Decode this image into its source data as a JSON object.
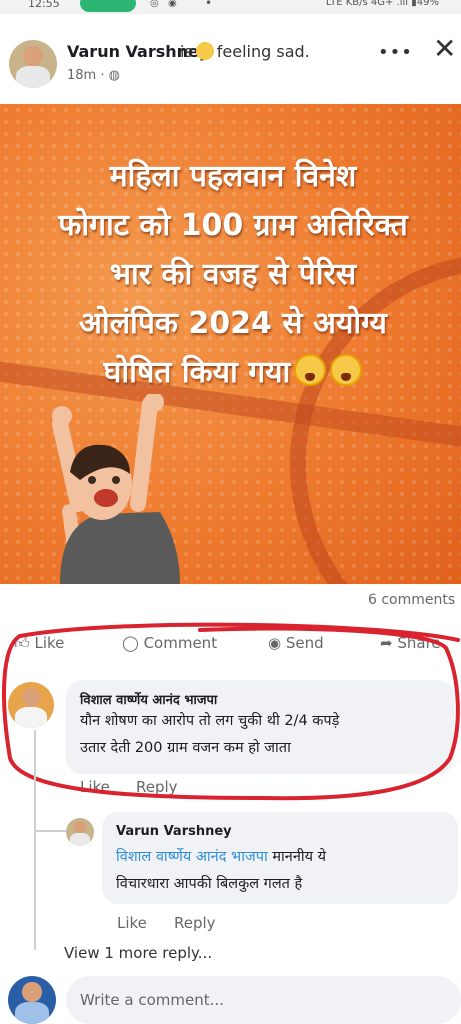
{
  "status_bar": {
    "time": "12:55",
    "network": "LTE KB/s 4G+ .ıll",
    "battery": "49%"
  },
  "post": {
    "author": "Varun Varshney",
    "feeling_prefix": "is",
    "feeling_text": "feeling sad.",
    "time": "18m ·",
    "headline_lines": [
      "महिला पहलवान विनेश",
      "फोगाट को 100 ग्राम अतिरिक्त",
      "भार की वजह से पेरिस",
      "ओलंपिक 2024 से  अयोग्य",
      "घोषित किया गया"
    ],
    "comments_count": "6 comments"
  },
  "actions": {
    "like": "Like",
    "comment": "Comment",
    "send": "Send",
    "share": "Share"
  },
  "comments": [
    {
      "author": "विशाल वार्ष्णेय आनंद भाजपा",
      "text_line1": "यौन शोषण का आरोप तो लग चुकी थी 2/4 कपड़े",
      "text_line2": "उतार देती 200 ग्राम वजन कम हो जाता",
      "like": "Like",
      "reply": "Reply"
    }
  ],
  "reply": {
    "author": "Varun Varshney",
    "mention": "विशाल वार्ष्णेय आनंद भाजपा",
    "text_after_mention": " माननीय ये",
    "text_line2": "विचारधारा आपकी बिलकुल गलत है",
    "like": "Like",
    "reply": "Reply"
  },
  "view_more": "View 1 more reply...",
  "composer": {
    "placeholder": "Write a comment..."
  },
  "colors": {
    "accent_link": "#2e8fd6",
    "annotation_red": "#d9232f",
    "image_orange": "#ee7a2e",
    "status_call": "#2bb673"
  }
}
